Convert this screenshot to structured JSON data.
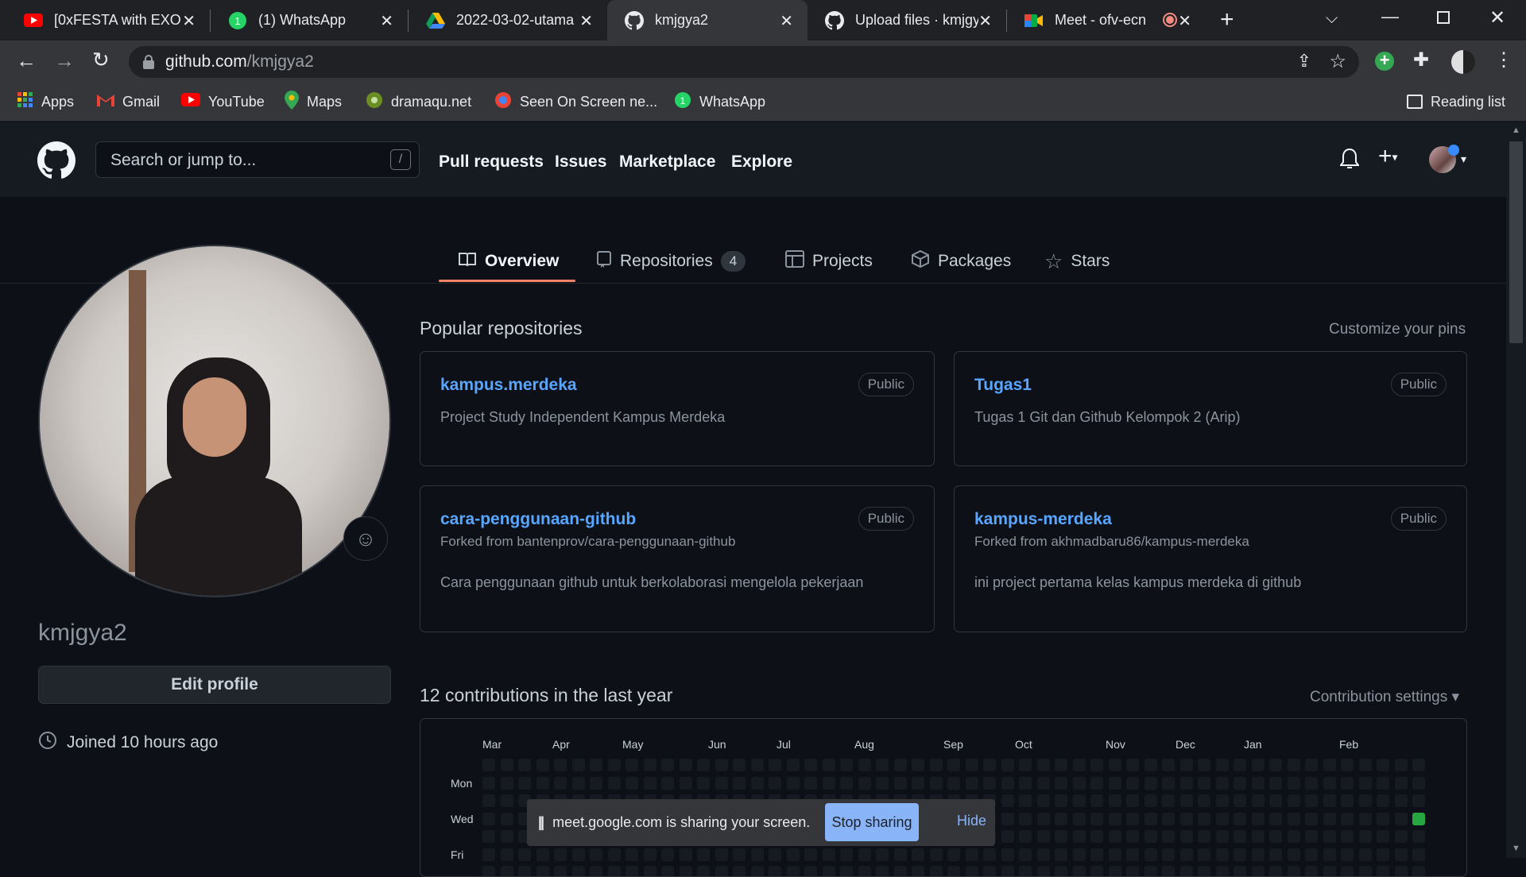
{
  "browser": {
    "tabs": [
      {
        "title": "[0xFESTA with EXO",
        "icon": "youtube-icon"
      },
      {
        "title": "(1) WhatsApp",
        "icon": "whatsapp-icon"
      },
      {
        "title": "2022-03-02-utama",
        "icon": "google-drive-icon"
      },
      {
        "title": "kmjgya2",
        "icon": "github-icon",
        "active": true
      },
      {
        "title": "Upload files · kmjgy",
        "icon": "github-icon"
      },
      {
        "title": "Meet - ofv-ecn",
        "icon": "google-meet-icon"
      }
    ],
    "url_host": "github.com",
    "url_path": "/kmjgya2",
    "bookmarks": [
      {
        "label": "Apps",
        "icon": "apps-grid-icon"
      },
      {
        "label": "Gmail",
        "icon": "gmail-icon"
      },
      {
        "label": "YouTube",
        "icon": "youtube-icon"
      },
      {
        "label": "Maps",
        "icon": "maps-icon"
      },
      {
        "label": "dramaqu.net",
        "icon": "dramaqu-icon"
      },
      {
        "label": "Seen On Screen ne...",
        "icon": "seenonscreen-icon"
      },
      {
        "label": "WhatsApp",
        "icon": "whatsapp-icon"
      }
    ],
    "reading_list": "Reading list"
  },
  "github": {
    "search_placeholder": "Search or jump to...",
    "search_shortcut": "/",
    "nav": [
      "Pull requests",
      "Issues",
      "Marketplace",
      "Explore"
    ],
    "profile_tabs": [
      {
        "label": "Overview",
        "active": true
      },
      {
        "label": "Repositories",
        "count": "4"
      },
      {
        "label": "Projects"
      },
      {
        "label": "Packages"
      },
      {
        "label": "Stars"
      }
    ],
    "username": "kmjgya2",
    "edit_profile": "Edit profile",
    "joined": "Joined 10 hours ago",
    "popular_title": "Popular repositories",
    "customize_pins": "Customize your pins",
    "repos": [
      {
        "name": "kampus.merdeka",
        "visibility": "Public",
        "forked_from": "",
        "description": "Project Study Independent Kampus Merdeka"
      },
      {
        "name": "Tugas1",
        "visibility": "Public",
        "forked_from": "",
        "description": "Tugas 1 Git dan Github Kelompok 2 (Arip)"
      },
      {
        "name": "cara-penggunaan-github",
        "visibility": "Public",
        "forked_from": "Forked from bantenprov/cara-penggunaan-github",
        "description": "Cara penggunaan github untuk berkolaborasi mengelola pekerjaan"
      },
      {
        "name": "kampus-merdeka",
        "visibility": "Public",
        "forked_from": "Forked from akhmadbaru86/kampus-merdeka",
        "description": "ini project pertama kelas kampus merdeka di github"
      }
    ],
    "contributions_title": "12 contributions in the last year",
    "contribution_settings": "Contribution settings ▾",
    "months": [
      "Mar",
      "Apr",
      "May",
      "Jun",
      "Jul",
      "Aug",
      "Sep",
      "Oct",
      "Nov",
      "Dec",
      "Jan",
      "Feb"
    ],
    "day_labels": [
      "Mon",
      "Wed",
      "Fri"
    ]
  },
  "screen_share": {
    "message": "meet.google.com is sharing your screen.",
    "stop": "Stop sharing",
    "hide": "Hide"
  },
  "colors": {
    "bg": "#0d1117",
    "header": "#161b22",
    "link": "#58a6ff",
    "accent_underline": "#f78166",
    "contrib_green": "#26a641"
  }
}
